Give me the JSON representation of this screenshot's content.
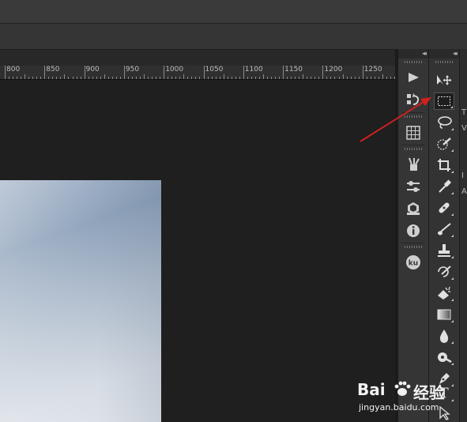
{
  "ruler": {
    "labels": [
      "800",
      "850",
      "900",
      "950",
      "1000",
      "1050",
      "1100",
      "1150",
      "1200",
      "1250"
    ]
  },
  "panel_icons": [
    "play-icon",
    "history-icon",
    "swatches-grid-icon",
    "brushes-icon",
    "adjust-sliders-icon",
    "3d-icon",
    "info-icon",
    "kuler-icon"
  ],
  "kuler_label": "ku",
  "tools": [
    {
      "name": "move-tool",
      "icon": "move-icon"
    },
    {
      "name": "rectangular-marquee-tool",
      "icon": "marquee-icon",
      "selected": true
    },
    {
      "name": "lasso-tool",
      "icon": "lasso-icon"
    },
    {
      "name": "quick-selection-tool",
      "icon": "quick-select-icon"
    },
    {
      "name": "crop-tool",
      "icon": "crop-icon"
    },
    {
      "name": "eyedropper-tool",
      "icon": "eyedropper-icon"
    },
    {
      "name": "healing-brush-tool",
      "icon": "bandage-icon"
    },
    {
      "name": "brush-tool",
      "icon": "brush-icon"
    },
    {
      "name": "clone-stamp-tool",
      "icon": "stamp-icon"
    },
    {
      "name": "history-brush-tool",
      "icon": "history-brush-icon"
    },
    {
      "name": "eraser-tool",
      "icon": "eraser-icon"
    },
    {
      "name": "gradient-tool",
      "icon": "gradient-icon"
    },
    {
      "name": "blur-tool",
      "icon": "drop-icon"
    },
    {
      "name": "dodge-tool",
      "icon": "dodge-icon"
    },
    {
      "name": "pen-tool",
      "icon": "pen-icon"
    },
    {
      "name": "type-tool",
      "icon": "type-icon"
    },
    {
      "name": "path-selection-tool",
      "icon": "arrow-icon"
    }
  ],
  "type_tool_label": "T",
  "right_edge_chars": [
    "T",
    "V",
    "I",
    "A"
  ],
  "watermark": {
    "brand": "Bai",
    "brand2": "经验",
    "url": "jingyan.baidu.com"
  },
  "colors": {
    "annotation_arrow": "#d0201f",
    "workspace": "#1f1f1f"
  }
}
